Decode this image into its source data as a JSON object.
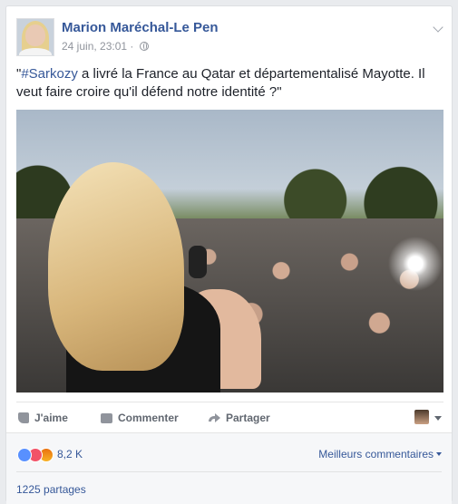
{
  "post": {
    "page_name": "Marion Maréchal-Le Pen",
    "timestamp": "24 juin, 23:01",
    "privacy_separator": "·",
    "text_hashtag": "#Sarkozy",
    "text_quote_open": "\"",
    "text_rest": " a livré la France au Qatar et départementalisé Mayotte. Il veut faire croire qu'il défend notre identité ?\""
  },
  "actions": {
    "like": "J'aime",
    "comment": "Commenter",
    "share": "Partager"
  },
  "reactions": {
    "count": "8,2 K",
    "top_comments": "Meilleurs commentaires",
    "shares": "1225 partages"
  },
  "colors": {
    "link": "#365899",
    "background": "#e9ebee",
    "card": "#ffffff"
  },
  "icons": [
    "globe-icon",
    "chevron-down-icon",
    "like-icon",
    "comment-icon",
    "share-icon",
    "like-reaction-icon",
    "love-reaction-icon",
    "angry-reaction-icon"
  ]
}
